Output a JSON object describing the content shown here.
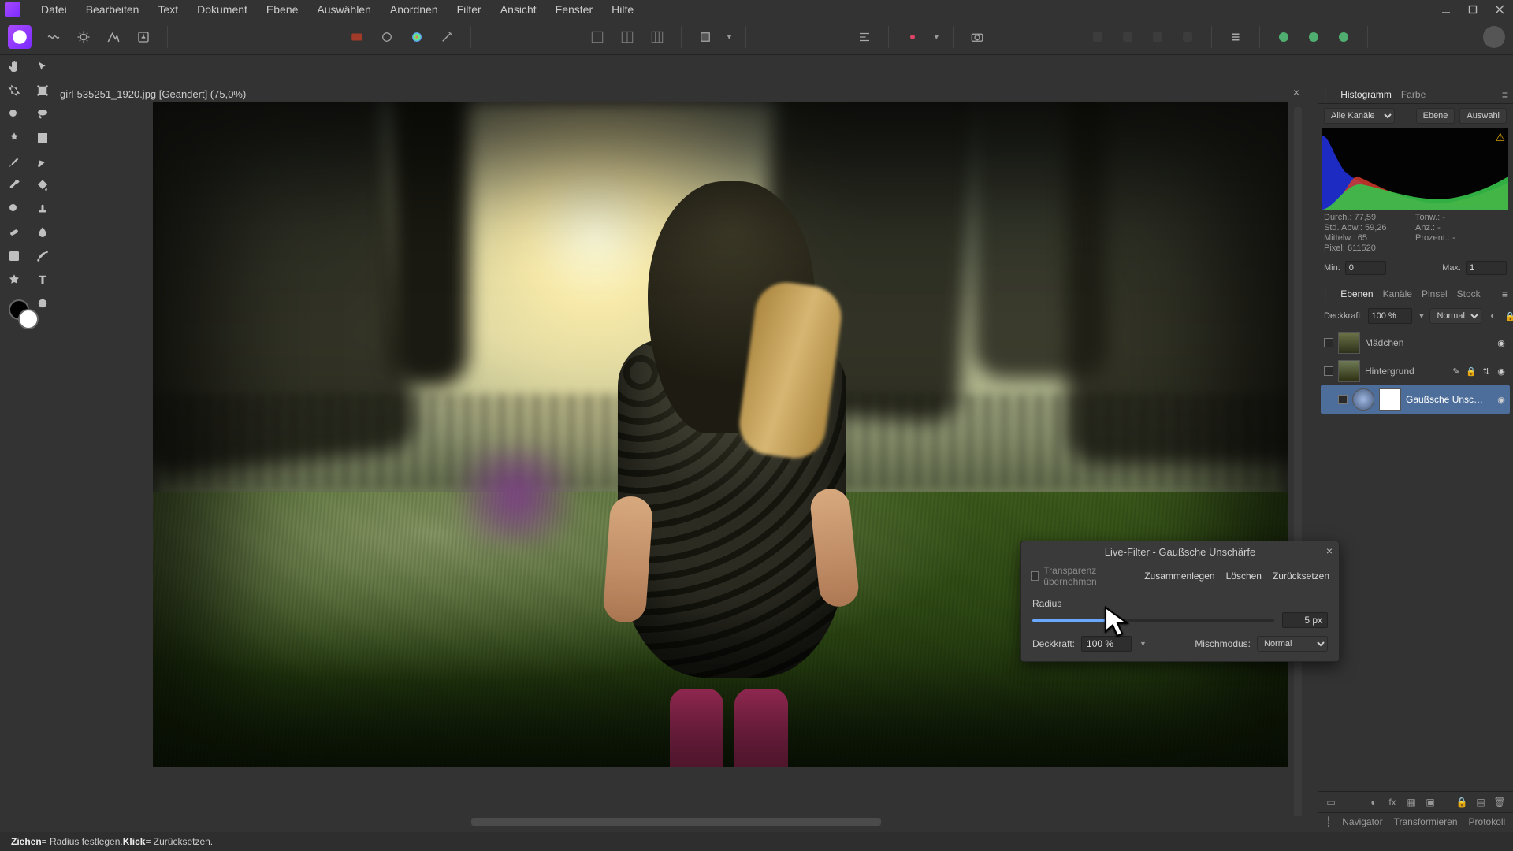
{
  "menubar": {
    "items": [
      "Datei",
      "Bearbeiten",
      "Text",
      "Dokument",
      "Ebene",
      "Auswählen",
      "Anordnen",
      "Filter",
      "Ansicht",
      "Fenster",
      "Hilfe"
    ]
  },
  "document": {
    "tab_label": "girl-535251_1920.jpg [Geändert] (75,0%)"
  },
  "histogram_panel": {
    "tabs": [
      "Histogramm",
      "Farbe"
    ],
    "channel": "Alle Kanäle",
    "btn_layer": "Ebene",
    "btn_selection": "Auswahl",
    "stats": {
      "mean_label": "Durch.:",
      "mean_val": "77,59",
      "std_label": "Std. Abw.:",
      "std_val": "59,26",
      "median_label": "Mittelw.:",
      "median_val": "65",
      "pixels_label": "Pixel:",
      "pixels_val": "611520",
      "tone_label": "Tonw.:",
      "tone_val": "-",
      "count_label": "Anz.:",
      "count_val": "-",
      "percent_label": "Prozent.:",
      "percent_val": "-"
    },
    "min_label": "Min:",
    "min_val": "0",
    "max_label": "Max:",
    "max_val": "1"
  },
  "layers_panel": {
    "tabs": [
      "Ebenen",
      "Kanäle",
      "Pinsel",
      "Stock"
    ],
    "opacity_label": "Deckkraft:",
    "opacity_val": "100 %",
    "blend_val": "Normal",
    "layers": [
      {
        "name": "Mädchen"
      },
      {
        "name": "Hintergrund"
      },
      {
        "name": "Gaußsche Unsc…"
      }
    ]
  },
  "bottom_tabs": [
    "Navigator",
    "Transformieren",
    "Protokoll"
  ],
  "dialog": {
    "title": "Live-Filter - Gaußsche Unschärfe",
    "preserve_alpha": "Transparenz übernehmen",
    "merge": "Zusammenlegen",
    "delete": "Löschen",
    "reset": "Zurücksetzen",
    "radius_label": "Radius",
    "radius_val": "5 px",
    "opacity_label": "Deckkraft:",
    "opacity_val": "100 %",
    "blend_label": "Mischmodus:",
    "blend_val": "Normal"
  },
  "status": {
    "drag_word": "Ziehen",
    "drag_rest": " = Radius festlegen. ",
    "click_word": "Klick",
    "click_rest": " = Zurücksetzen."
  }
}
